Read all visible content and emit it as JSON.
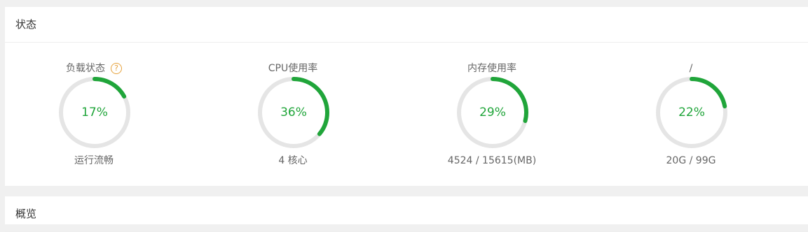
{
  "status_panel": {
    "title": "状态",
    "gauges": [
      {
        "title": "负载状态",
        "has_help": true,
        "percent": 17,
        "value_label": "17%",
        "desc": "运行流畅"
      },
      {
        "title": "CPU使用率",
        "has_help": false,
        "percent": 36,
        "value_label": "36%",
        "desc": "4 核心"
      },
      {
        "title": "内存使用率",
        "has_help": false,
        "percent": 29,
        "value_label": "29%",
        "desc": "4524 / 15615(MB)"
      },
      {
        "title": "/",
        "has_help": false,
        "percent": 22,
        "value_label": "22%",
        "desc": "20G / 99G"
      }
    ]
  },
  "help_icon_glyph": "?",
  "overview_panel": {
    "title": "概览"
  },
  "colors": {
    "accent": "#20a53a",
    "track": "#e5e5e5",
    "help": "#e6a23c"
  }
}
